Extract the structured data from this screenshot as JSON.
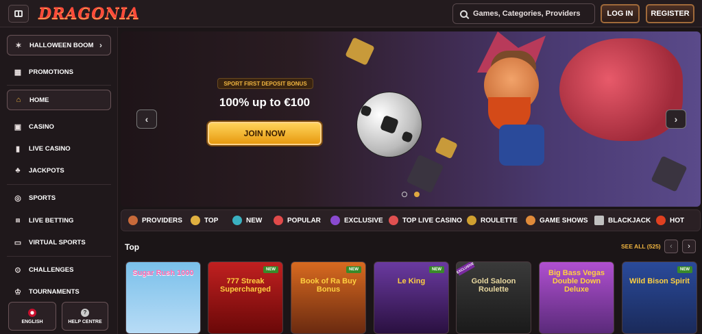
{
  "header": {
    "logo": "DRAGONIA",
    "search_placeholder": "Games, Categories, Providers",
    "login": "LOG IN",
    "register": "REGISTER"
  },
  "sidebar": {
    "items": [
      {
        "label": "HALLOWEEN BOOM",
        "icon": "bat-icon"
      },
      {
        "label": "PROMOTIONS",
        "icon": "gift-icon"
      },
      {
        "label": "HOME",
        "icon": "home-icon"
      },
      {
        "label": "CASINO",
        "icon": "slot-icon"
      },
      {
        "label": "LIVE CASINO",
        "icon": "cards-icon"
      },
      {
        "label": "JACKPOTS",
        "icon": "clover-icon"
      },
      {
        "label": "SPORTS",
        "icon": "ball-icon"
      },
      {
        "label": "LIVE BETTING",
        "icon": "live-icon"
      },
      {
        "label": "VIRTUAL SPORTS",
        "icon": "monitor-icon"
      },
      {
        "label": "CHALLENGES",
        "icon": "target-icon"
      },
      {
        "label": "TOURNAMENTS",
        "icon": "trophy-icon"
      }
    ],
    "language": "ENGLISH",
    "help": "HELP CENTRE"
  },
  "banner": {
    "tag": "SPORT FIRST DEPOSIT BONUS",
    "title": "100% up to €100",
    "cta": "JOIN NOW",
    "active_slide": 2,
    "slides": 2
  },
  "categories": [
    {
      "label": "PROVIDERS",
      "color": "#c86a3a"
    },
    {
      "label": "TOP",
      "color": "#e0b040"
    },
    {
      "label": "NEW",
      "color": "#3ab0c0"
    },
    {
      "label": "POPULAR",
      "color": "#e04a4a"
    },
    {
      "label": "EXCLUSIVE",
      "color": "#8a4ad0"
    },
    {
      "label": "TOP LIVE CASINO",
      "color": "#e05050"
    },
    {
      "label": "ROULETTE",
      "color": "#d0a030"
    },
    {
      "label": "GAME SHOWS",
      "color": "#e08a3a"
    },
    {
      "label": "BLACKJACK",
      "color": "#c0c0c0"
    },
    {
      "label": "HOT",
      "color": "#e04020"
    }
  ],
  "section": {
    "title": "Top",
    "see_all": "SEE ALL (525)"
  },
  "games": [
    {
      "title": "Sugar Rush 1000",
      "badge": "",
      "bg": "#6ab0e0",
      "fg": "#ff6ab0"
    },
    {
      "title": "777 Streak Supercharged",
      "badge": "NEW",
      "bg": "#a01818",
      "fg": "#ffd040"
    },
    {
      "title": "Book of Ra Buy Bonus",
      "badge": "NEW",
      "bg": "#c0501a",
      "fg": "#ffd040"
    },
    {
      "title": "Le King",
      "badge": "NEW",
      "bg": "#5a2a8a",
      "fg": "#ffd040"
    },
    {
      "title": "Gold Saloon Roulette",
      "badge": "EXCLUSIVE",
      "bg": "#2a2a2a",
      "fg": "#e8d8a0"
    },
    {
      "title": "Big Bass Vegas Double Down Deluxe",
      "badge": "",
      "bg": "#a040c0",
      "fg": "#ffd040"
    },
    {
      "title": "Wild Bison Spirit",
      "badge": "NEW",
      "bg": "#1a3a7a",
      "fg": "#ffd040"
    }
  ]
}
